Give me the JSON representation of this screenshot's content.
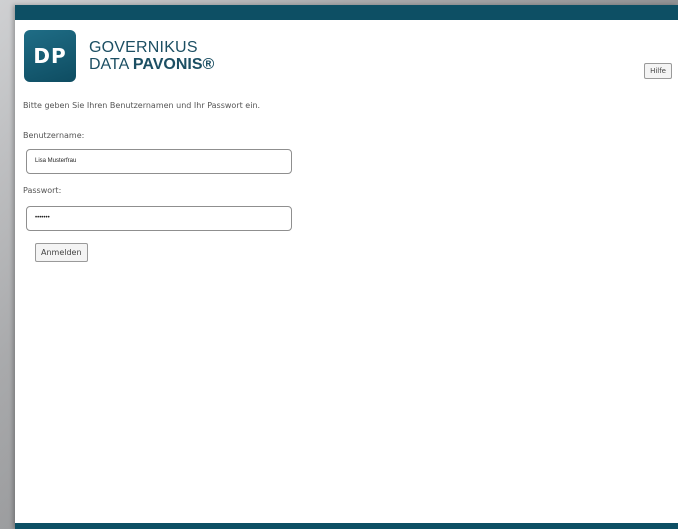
{
  "header": {
    "logo_initials": "DP",
    "logo_line1": "GOVERNIKUS",
    "logo_line2_regular": "DATA ",
    "logo_line2_bold": "PAVONIS®",
    "help_label": "Hilfe"
  },
  "login": {
    "intro": "Bitte geben Sie Ihren Benutzernamen und Ihr Passwort ein.",
    "username_label": "Benutzername:",
    "username_value": "Lisa Musterfrau",
    "password_label": "Passwort:",
    "password_value": "•••••••",
    "submit_label": "Anmelden"
  },
  "colors": {
    "brand": "#0d4f64"
  }
}
